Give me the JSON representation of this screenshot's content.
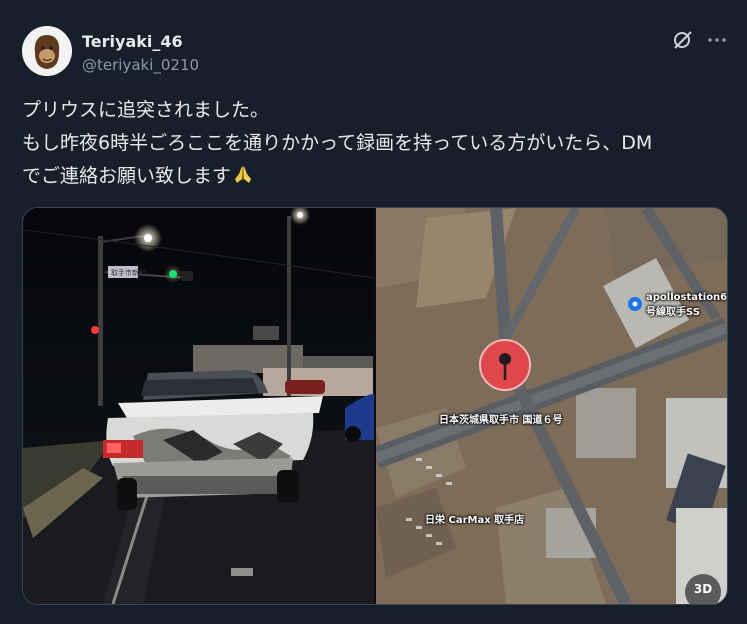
{
  "author": {
    "display_name": "Teriyaki_46",
    "handle": "@teriyaki_0210"
  },
  "tweet": {
    "lines": [
      "プリウスに追突されました。",
      "もし昨夜6時半ごろここを通りかかって録画を持っている方がいたら、DM",
      "でご連絡お願い致します"
    ],
    "emoji_icon": "folded-hands-icon"
  },
  "header_icons": [
    "grok-icon",
    "more-icon"
  ],
  "media": {
    "left_photo": {
      "sign_text": "取手市新町"
    },
    "map": {
      "poi_label": "apollostation6号線取手SS",
      "poi_line1": "apollostation6",
      "poi_line2": "号線取手SS",
      "pin_address": "日本茨城県取手市 国道６号",
      "shop_label": "日栄 CarMax 取手店",
      "badge": "3D"
    }
  },
  "colors": {
    "background": "#15202b",
    "text": "#e7e9ea",
    "secondary_text": "#8b98a5",
    "pin": "#e0474c"
  }
}
